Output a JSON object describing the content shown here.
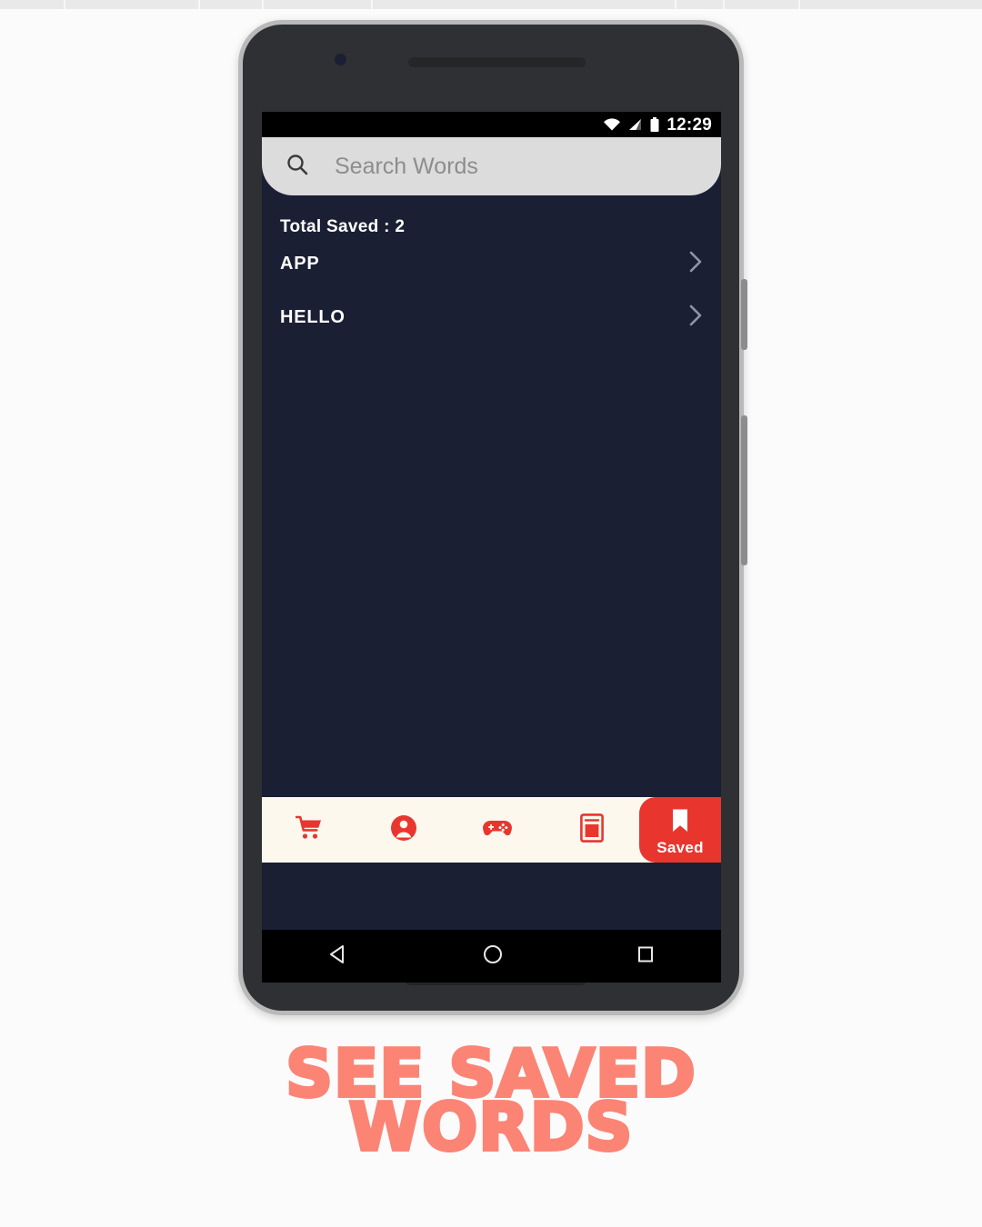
{
  "caption": {
    "line1": "See Saved",
    "line2": "Words"
  },
  "phone": {
    "camera_icon": "camera-dot",
    "earpiece_icon": "earpiece-speaker",
    "power_button": "power-button",
    "volume_button": "volume-rocker"
  },
  "statusbar": {
    "wifi_icon": "wifi-icon",
    "signal_icon": "cellular-signal-icon",
    "battery_icon": "battery-icon",
    "time": "12:29"
  },
  "search": {
    "icon": "search-icon",
    "placeholder": "Search Words",
    "value": ""
  },
  "main": {
    "total_saved_label": "Total Saved : 2",
    "saved_count": 2,
    "words": [
      {
        "label": "APP",
        "chevron": "chevron-right-icon"
      },
      {
        "label": "HELLO",
        "chevron": "chevron-right-icon"
      }
    ]
  },
  "bottomnav": {
    "items": [
      {
        "icon": "shopping-cart-icon",
        "name": "cart",
        "active": false,
        "label": ""
      },
      {
        "icon": "account-circle-icon",
        "name": "profile",
        "active": false,
        "label": ""
      },
      {
        "icon": "gamepad-icon",
        "name": "games",
        "active": false,
        "label": ""
      },
      {
        "icon": "book-icon",
        "name": "dictionary",
        "active": false,
        "label": ""
      },
      {
        "icon": "bookmark-icon",
        "name": "saved",
        "active": true,
        "label": "Saved"
      }
    ],
    "active_label": "Saved"
  },
  "androidnav": {
    "back_icon": "back-triangle-icon",
    "home_icon": "home-circle-icon",
    "recents_icon": "recents-square-icon"
  },
  "colors": {
    "app_background": "#1a1f33",
    "accent_red": "#e8362f",
    "nav_background": "#fdf8ee",
    "search_background": "#dcdcdc",
    "caption_color": "#fb8475",
    "text_white": "#ffffff"
  }
}
